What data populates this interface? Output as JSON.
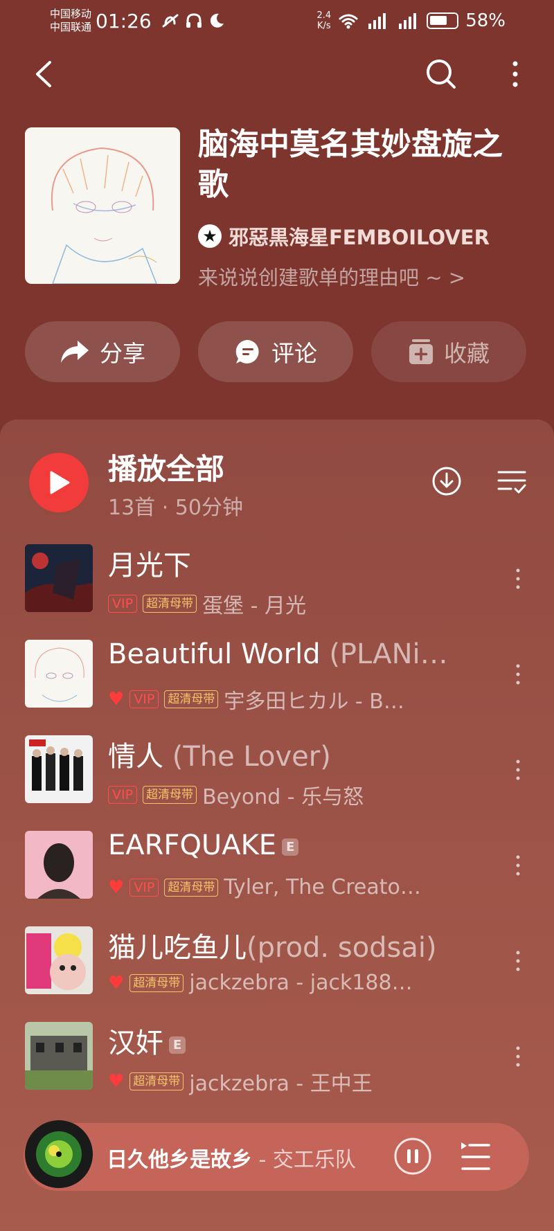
{
  "status_bar": {
    "carrier1": "中国移动",
    "carrier2": "中国联通",
    "time": "01:26",
    "speed_value": "2.4",
    "speed_unit": "K/s",
    "battery": "58%"
  },
  "playlist": {
    "title": "脑海中莫名其妙盘旋之歌",
    "creator": "邪惡黒海星FEMBOILOVER",
    "description": "来说说创建歌单的理由吧 ~ >"
  },
  "actions": {
    "share": "分享",
    "comment": "评论",
    "collect": "收藏"
  },
  "list_header": {
    "play_all": "播放全部",
    "meta": "13首 · 50分钟"
  },
  "tags": {
    "vip": "VIP",
    "hq": "超清母带",
    "explicit": "E"
  },
  "songs": [
    {
      "title": "月光下",
      "subtitle": "",
      "liked": false,
      "vip": true,
      "hq": true,
      "explicit": false,
      "meta": "蛋堡 - 月光"
    },
    {
      "title": "Beautiful World ",
      "subtitle": "(PLANi…",
      "liked": true,
      "vip": true,
      "hq": true,
      "explicit": false,
      "meta": "宇多田ヒカル - B…"
    },
    {
      "title": "情人 ",
      "subtitle": "(The Lover)",
      "liked": false,
      "vip": true,
      "hq": true,
      "explicit": false,
      "meta": "Beyond - 乐与怒"
    },
    {
      "title": "EARFQUAKE",
      "subtitle": "",
      "liked": true,
      "vip": true,
      "hq": true,
      "explicit": true,
      "meta": "Tyler, The Creato…"
    },
    {
      "title": "猫儿吃鱼儿",
      "subtitle": "(prod. sodsai)",
      "liked": true,
      "vip": false,
      "hq": true,
      "explicit": false,
      "meta": "jackzebra - jack188…"
    },
    {
      "title": "汉奸",
      "subtitle": "",
      "liked": true,
      "vip": false,
      "hq": true,
      "explicit": true,
      "meta": "jackzebra - 王中王"
    }
  ],
  "now_playing": {
    "title": "日久他乡是故乡",
    "artist": " - 交工乐队"
  },
  "colors": {
    "background": "#7d352e",
    "play_button": "#f23b3b",
    "vip": "#ff4d4d",
    "hq": "#f5c46a",
    "mini_player": "#c5655a"
  }
}
